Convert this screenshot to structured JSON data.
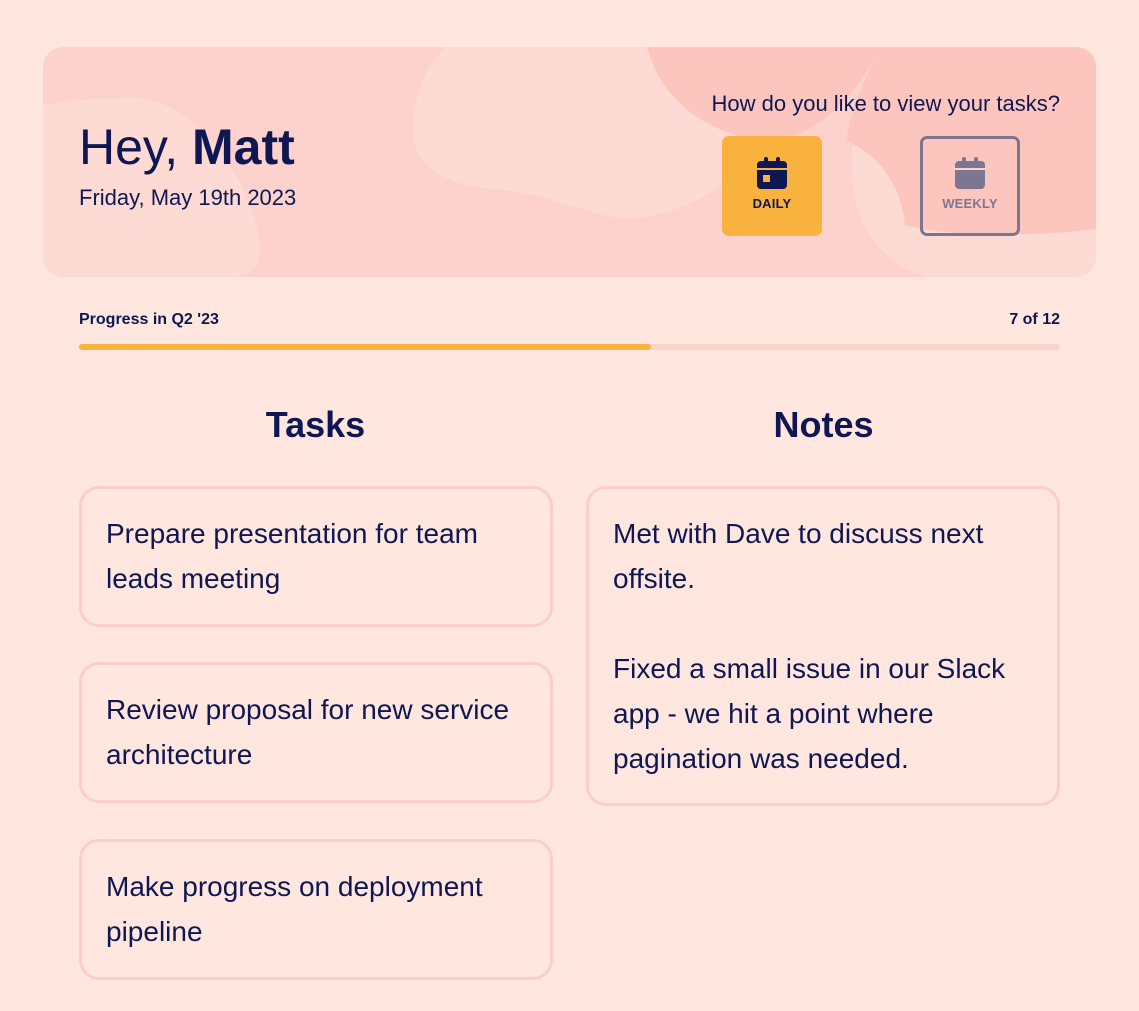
{
  "header": {
    "greeting_prefix": "Hey,",
    "user_name": "Matt",
    "date": "Friday, May 19th 2023",
    "view_question": "How do you like to view your tasks?",
    "view_options": [
      {
        "label": "DAILY",
        "icon": "calendar-icon",
        "selected": true
      },
      {
        "label": "WEEKLY",
        "icon": "calendar-icon",
        "selected": false
      }
    ]
  },
  "progress": {
    "label": "Progress in Q2 '23",
    "count_text": "7 of 12",
    "completed": 7,
    "total": 12,
    "fill_color": "#F8B23D"
  },
  "tasks": {
    "title": "Tasks",
    "items": [
      "Prepare presentation for team leads meeting",
      "Review proposal for new service architecture",
      "Make progress on deployment pipeline"
    ]
  },
  "notes": {
    "title": "Notes",
    "paragraphs": [
      "Met with Dave to discuss next offsite.",
      "Fixed a small issue in our Slack app - we hit a point where pagination was needed."
    ]
  },
  "colors": {
    "background": "#FFE7E0",
    "header_bg": "#FDD2CC",
    "accent": "#F8B23D",
    "text": "#0F1752",
    "muted": "#7D7690",
    "card_border": "#FBCFC7"
  }
}
